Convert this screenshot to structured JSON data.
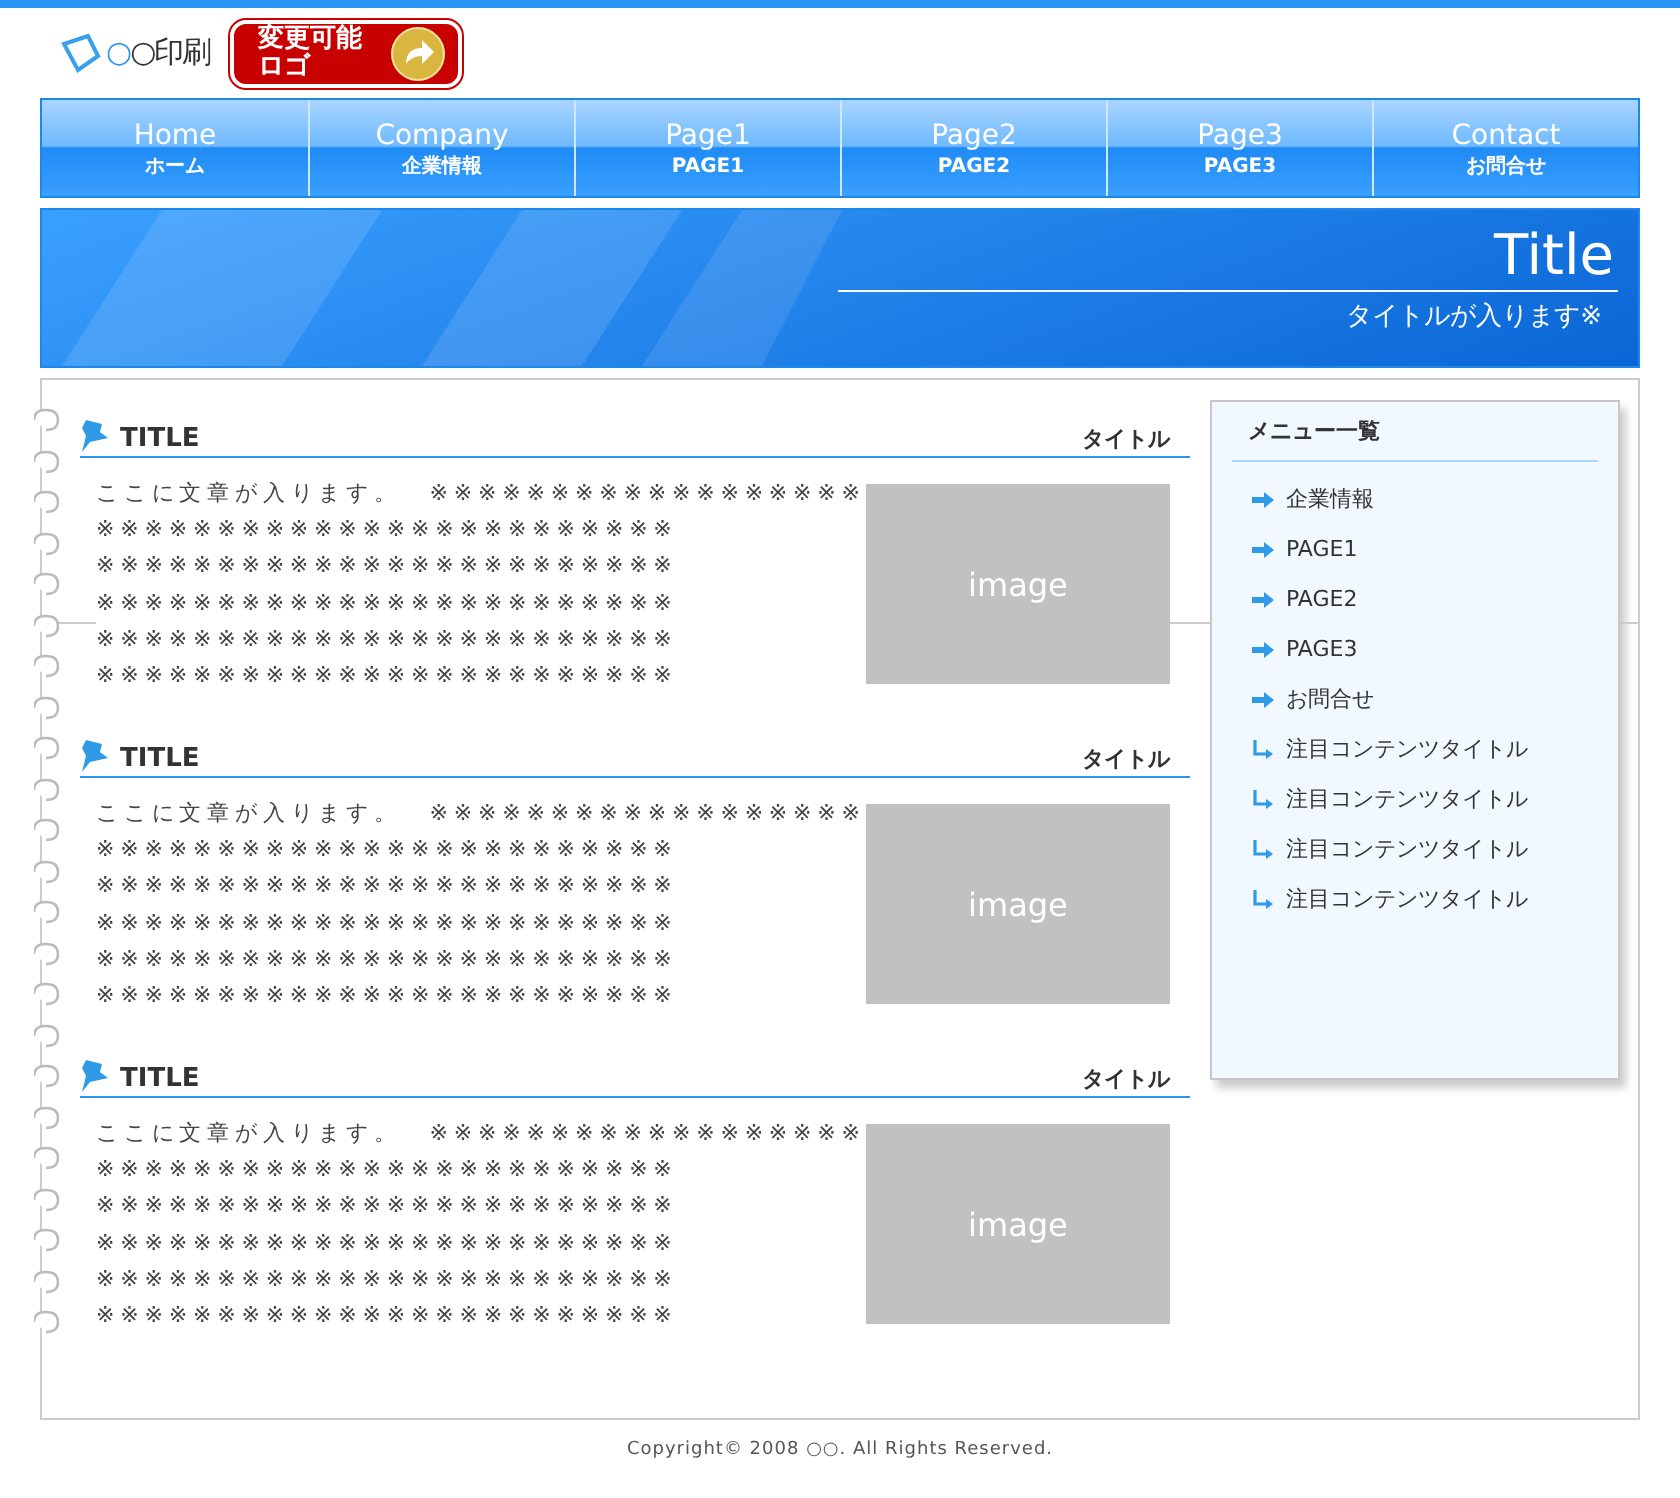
{
  "logo": {
    "text": "○○印刷",
    "badge_lines": [
      "変更可能",
      "ロゴ"
    ]
  },
  "nav": [
    {
      "label": "Home",
      "sub": "ホーム"
    },
    {
      "label": "Company",
      "sub": "企業情報"
    },
    {
      "label": "Page1",
      "sub": "PAGE1"
    },
    {
      "label": "Page2",
      "sub": "PAGE2"
    },
    {
      "label": "Page3",
      "sub": "PAGE3"
    },
    {
      "label": "Contact",
      "sub": "お問合せ"
    }
  ],
  "banner": {
    "title": "Title",
    "subtitle": "タイトルが入ります※"
  },
  "articles": [
    {
      "title": "TITLE",
      "tag": "タイトル",
      "lines": [
        "ここに文章が入ります。　※※※※※※※※※※※※※※※※※※",
        "※※※※※※※※※※※※※※※※※※※※※※※※",
        "※※※※※※※※※※※※※※※※※※※※※※※※",
        "※※※※※※※※※※※※※※※※※※※※※※※※",
        "※※※※※※※※※※※※※※※※※※※※※※※※",
        "※※※※※※※※※※※※※※※※※※※※※※※※"
      ],
      "image": "image"
    },
    {
      "title": "TITLE",
      "tag": "タイトル",
      "lines": [
        "ここに文章が入ります。　※※※※※※※※※※※※※※※※※※",
        "※※※※※※※※※※※※※※※※※※※※※※※※",
        "※※※※※※※※※※※※※※※※※※※※※※※※",
        "※※※※※※※※※※※※※※※※※※※※※※※※",
        "※※※※※※※※※※※※※※※※※※※※※※※※",
        "※※※※※※※※※※※※※※※※※※※※※※※※"
      ],
      "image": "image"
    },
    {
      "title": "TITLE",
      "tag": "タイトル",
      "lines": [
        "ここに文章が入ります。　※※※※※※※※※※※※※※※※※※",
        "※※※※※※※※※※※※※※※※※※※※※※※※",
        "※※※※※※※※※※※※※※※※※※※※※※※※",
        "※※※※※※※※※※※※※※※※※※※※※※※※",
        "※※※※※※※※※※※※※※※※※※※※※※※※",
        "※※※※※※※※※※※※※※※※※※※※※※※※"
      ],
      "image": "image"
    }
  ],
  "sidebar": {
    "title": "メニュー一覧",
    "items": [
      {
        "kind": "page",
        "label": "企業情報"
      },
      {
        "kind": "page",
        "label": "PAGE1"
      },
      {
        "kind": "page",
        "label": "PAGE2"
      },
      {
        "kind": "page",
        "label": "PAGE3"
      },
      {
        "kind": "page",
        "label": "お問合せ"
      },
      {
        "kind": "sub",
        "label": "注目コンテンツタイトル"
      },
      {
        "kind": "sub",
        "label": "注目コンテンツタイトル"
      },
      {
        "kind": "sub",
        "label": "注目コンテンツタイトル"
      },
      {
        "kind": "sub",
        "label": "注目コンテンツタイトル"
      }
    ]
  },
  "footer": "Copyright© 2008 ○○. All Rights Reserved."
}
